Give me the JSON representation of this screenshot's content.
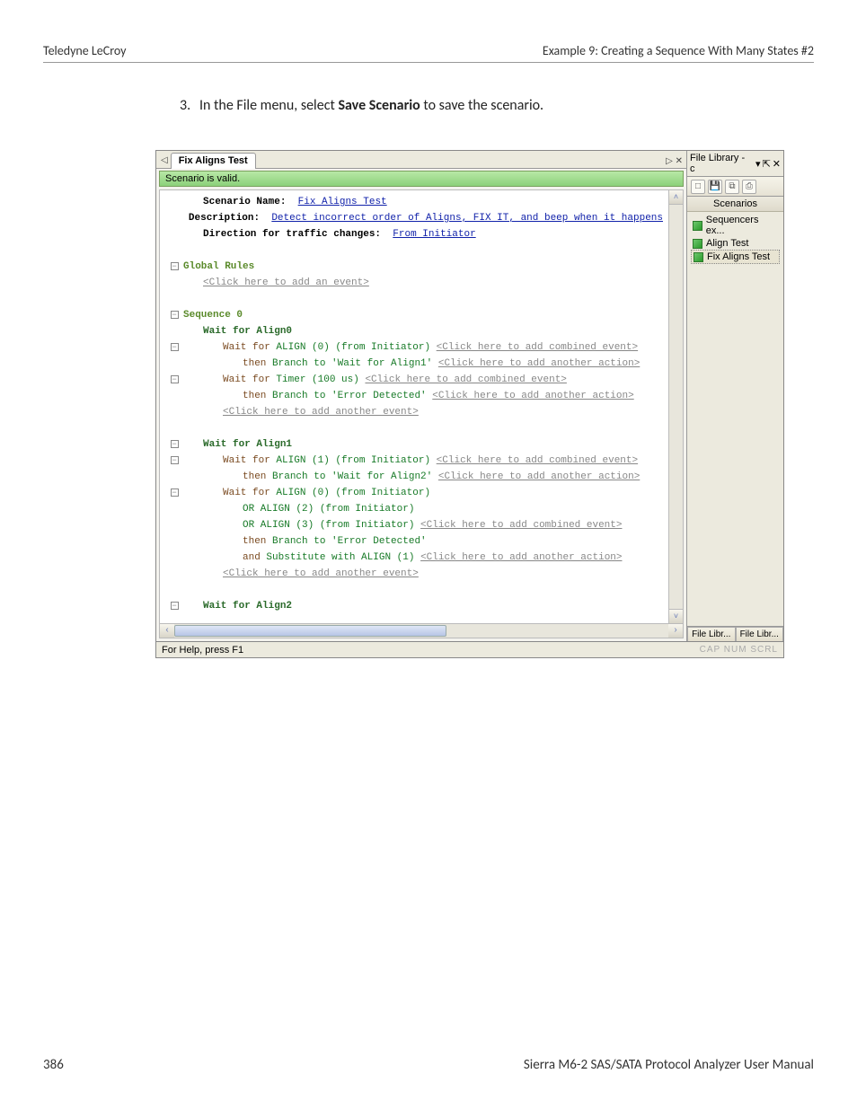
{
  "header": {
    "left": "Teledyne LeCroy",
    "right": "Example 9: Creating a Sequence With Many States #2"
  },
  "step": {
    "number": "3.",
    "pre": "In the File menu, select ",
    "bold": "Save Scenario",
    "post": " to save the scenario."
  },
  "tab": {
    "label": "Fix Aligns Test",
    "actions": "▷  ✕"
  },
  "valid": "Scenario is valid.",
  "info": {
    "name_label": "Scenario Name:",
    "name_value": "Fix Aligns Test",
    "desc_label": "Description:",
    "desc_value": "Detect incorrect order of Aligns, FIX IT, and beep when it happens",
    "dir_label": "Direction for traffic changes:",
    "dir_value": "From Initiator"
  },
  "hints": {
    "add_event": "<Click here to add an event>",
    "add_combined": "<Click here to add combined event>",
    "add_action": "<Click here to add another action>",
    "add_another_event": "<Click here to add another event>"
  },
  "global_rules": "Global Rules",
  "seq0": "Sequence 0",
  "s0": {
    "title": "Wait for Align0",
    "l1_a": "Wait for",
    "l1_b": "ALIGN (0) (from Initiator)",
    "l2_a": "then",
    "l2_b": "Branch to 'Wait for Align1'",
    "l3_a": "Wait for",
    "l3_b": "Timer (100 us)",
    "l4_a": "then",
    "l4_b": "Branch to 'Error Detected'"
  },
  "s1": {
    "title": "Wait for Align1",
    "l1_a": "Wait for",
    "l1_b": "ALIGN (1) (from Initiator)",
    "l2_a": "then",
    "l2_b": "Branch to 'Wait for Align2'",
    "l3_a": "Wait for",
    "l3_b": "ALIGN (0) (from Initiator)",
    "l4": "OR ALIGN (2) (from Initiator)",
    "l5": "OR ALIGN (3) (from Initiator)",
    "l6_a": "then",
    "l6_b": "Branch to 'Error Detected'",
    "l7_a": "and",
    "l7_b": "Substitute with ALIGN (1)"
  },
  "s2": {
    "title": "Wait for Align2"
  },
  "side": {
    "title": "File Library - c",
    "header": "Scenarios",
    "items": [
      "Sequencers ex...",
      "Align Test",
      "Fix Aligns Test"
    ],
    "tabs": [
      "File Libr...",
      "File Libr..."
    ]
  },
  "statusbar": {
    "left": "For Help, press F1",
    "right": "CAP  NUM  SCRL"
  },
  "footer": {
    "left": "386",
    "right": "Sierra M6-2 SAS/SATA Protocol Analyzer User Manual"
  }
}
